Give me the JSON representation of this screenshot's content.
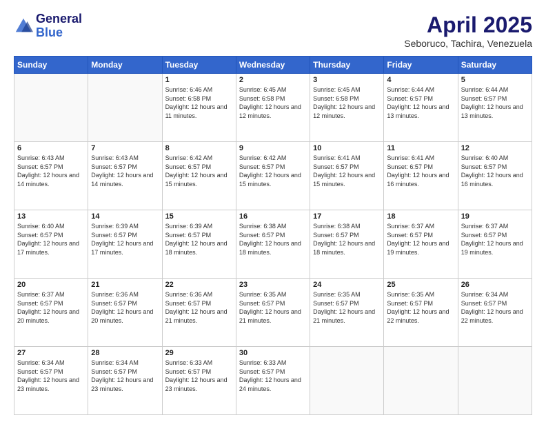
{
  "header": {
    "logo_line1": "General",
    "logo_line2": "Blue",
    "title": "April 2025",
    "subtitle": "Seboruco, Tachira, Venezuela"
  },
  "days_of_week": [
    "Sunday",
    "Monday",
    "Tuesday",
    "Wednesday",
    "Thursday",
    "Friday",
    "Saturday"
  ],
  "weeks": [
    [
      {
        "num": "",
        "info": ""
      },
      {
        "num": "",
        "info": ""
      },
      {
        "num": "1",
        "info": "Sunrise: 6:46 AM\nSunset: 6:58 PM\nDaylight: 12 hours and 11 minutes."
      },
      {
        "num": "2",
        "info": "Sunrise: 6:45 AM\nSunset: 6:58 PM\nDaylight: 12 hours and 12 minutes."
      },
      {
        "num": "3",
        "info": "Sunrise: 6:45 AM\nSunset: 6:58 PM\nDaylight: 12 hours and 12 minutes."
      },
      {
        "num": "4",
        "info": "Sunrise: 6:44 AM\nSunset: 6:57 PM\nDaylight: 12 hours and 13 minutes."
      },
      {
        "num": "5",
        "info": "Sunrise: 6:44 AM\nSunset: 6:57 PM\nDaylight: 12 hours and 13 minutes."
      }
    ],
    [
      {
        "num": "6",
        "info": "Sunrise: 6:43 AM\nSunset: 6:57 PM\nDaylight: 12 hours and 14 minutes."
      },
      {
        "num": "7",
        "info": "Sunrise: 6:43 AM\nSunset: 6:57 PM\nDaylight: 12 hours and 14 minutes."
      },
      {
        "num": "8",
        "info": "Sunrise: 6:42 AM\nSunset: 6:57 PM\nDaylight: 12 hours and 15 minutes."
      },
      {
        "num": "9",
        "info": "Sunrise: 6:42 AM\nSunset: 6:57 PM\nDaylight: 12 hours and 15 minutes."
      },
      {
        "num": "10",
        "info": "Sunrise: 6:41 AM\nSunset: 6:57 PM\nDaylight: 12 hours and 15 minutes."
      },
      {
        "num": "11",
        "info": "Sunrise: 6:41 AM\nSunset: 6:57 PM\nDaylight: 12 hours and 16 minutes."
      },
      {
        "num": "12",
        "info": "Sunrise: 6:40 AM\nSunset: 6:57 PM\nDaylight: 12 hours and 16 minutes."
      }
    ],
    [
      {
        "num": "13",
        "info": "Sunrise: 6:40 AM\nSunset: 6:57 PM\nDaylight: 12 hours and 17 minutes."
      },
      {
        "num": "14",
        "info": "Sunrise: 6:39 AM\nSunset: 6:57 PM\nDaylight: 12 hours and 17 minutes."
      },
      {
        "num": "15",
        "info": "Sunrise: 6:39 AM\nSunset: 6:57 PM\nDaylight: 12 hours and 18 minutes."
      },
      {
        "num": "16",
        "info": "Sunrise: 6:38 AM\nSunset: 6:57 PM\nDaylight: 12 hours and 18 minutes."
      },
      {
        "num": "17",
        "info": "Sunrise: 6:38 AM\nSunset: 6:57 PM\nDaylight: 12 hours and 18 minutes."
      },
      {
        "num": "18",
        "info": "Sunrise: 6:37 AM\nSunset: 6:57 PM\nDaylight: 12 hours and 19 minutes."
      },
      {
        "num": "19",
        "info": "Sunrise: 6:37 AM\nSunset: 6:57 PM\nDaylight: 12 hours and 19 minutes."
      }
    ],
    [
      {
        "num": "20",
        "info": "Sunrise: 6:37 AM\nSunset: 6:57 PM\nDaylight: 12 hours and 20 minutes."
      },
      {
        "num": "21",
        "info": "Sunrise: 6:36 AM\nSunset: 6:57 PM\nDaylight: 12 hours and 20 minutes."
      },
      {
        "num": "22",
        "info": "Sunrise: 6:36 AM\nSunset: 6:57 PM\nDaylight: 12 hours and 21 minutes."
      },
      {
        "num": "23",
        "info": "Sunrise: 6:35 AM\nSunset: 6:57 PM\nDaylight: 12 hours and 21 minutes."
      },
      {
        "num": "24",
        "info": "Sunrise: 6:35 AM\nSunset: 6:57 PM\nDaylight: 12 hours and 21 minutes."
      },
      {
        "num": "25",
        "info": "Sunrise: 6:35 AM\nSunset: 6:57 PM\nDaylight: 12 hours and 22 minutes."
      },
      {
        "num": "26",
        "info": "Sunrise: 6:34 AM\nSunset: 6:57 PM\nDaylight: 12 hours and 22 minutes."
      }
    ],
    [
      {
        "num": "27",
        "info": "Sunrise: 6:34 AM\nSunset: 6:57 PM\nDaylight: 12 hours and 23 minutes."
      },
      {
        "num": "28",
        "info": "Sunrise: 6:34 AM\nSunset: 6:57 PM\nDaylight: 12 hours and 23 minutes."
      },
      {
        "num": "29",
        "info": "Sunrise: 6:33 AM\nSunset: 6:57 PM\nDaylight: 12 hours and 23 minutes."
      },
      {
        "num": "30",
        "info": "Sunrise: 6:33 AM\nSunset: 6:57 PM\nDaylight: 12 hours and 24 minutes."
      },
      {
        "num": "",
        "info": ""
      },
      {
        "num": "",
        "info": ""
      },
      {
        "num": "",
        "info": ""
      }
    ]
  ]
}
